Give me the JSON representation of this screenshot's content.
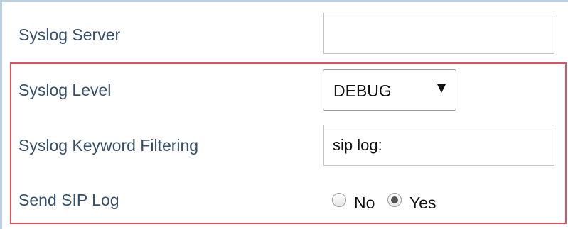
{
  "form": {
    "syslog_server": {
      "label": "Syslog Server",
      "value": ""
    },
    "syslog_level": {
      "label": "Syslog Level",
      "selected": "DEBUG"
    },
    "keyword_filtering": {
      "label": "Syslog Keyword Filtering",
      "value": "sip log:"
    },
    "send_sip_log": {
      "label": "Send SIP Log",
      "options": [
        {
          "label": "No",
          "checked": false
        },
        {
          "label": "Yes",
          "checked": true
        }
      ]
    }
  },
  "colors": {
    "label": "#36506b",
    "highlight": "#e0505a",
    "rule": "#b7cfe0"
  }
}
